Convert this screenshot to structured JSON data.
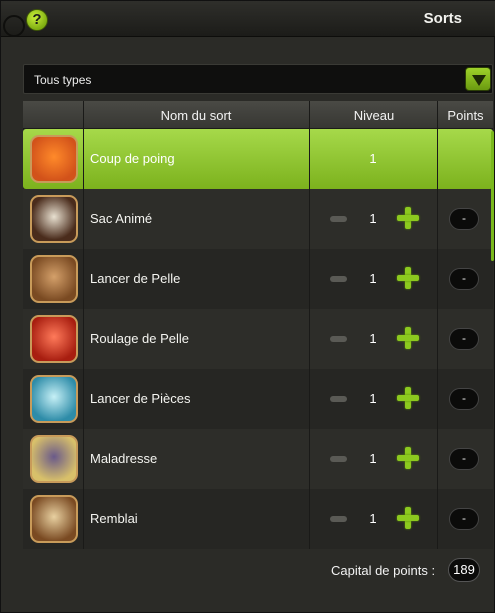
{
  "window": {
    "title": "Sorts",
    "help_label": "?"
  },
  "filter": {
    "selected": "Tous types"
  },
  "table": {
    "headers": {
      "name": "Nom du sort",
      "level": "Niveau",
      "points": "Points"
    }
  },
  "spells": [
    {
      "name": "Coup de poing",
      "level": "1",
      "points": "",
      "icon": "fist-icon",
      "selected": true
    },
    {
      "name": "Sac Animé",
      "level": "1",
      "points": "-",
      "icon": "sack-icon",
      "selected": false
    },
    {
      "name": "Lancer de Pelle",
      "level": "1",
      "points": "-",
      "icon": "shovel-throw-icon",
      "selected": false
    },
    {
      "name": "Roulage de Pelle",
      "level": "1",
      "points": "-",
      "icon": "shovel-roll-icon",
      "selected": false
    },
    {
      "name": "Lancer de Pièces",
      "level": "1",
      "points": "-",
      "icon": "coins-icon",
      "selected": false
    },
    {
      "name": "Maladresse",
      "level": "1",
      "points": "-",
      "icon": "clumsy-icon",
      "selected": false
    },
    {
      "name": "Remblai",
      "level": "1",
      "points": "-",
      "icon": "embankment-icon",
      "selected": false
    }
  ],
  "footer": {
    "capital_label": "Capital de points :",
    "capital_value": "189"
  },
  "colors": {
    "accent": "#8cc91f",
    "selected_row": "#a6d94a"
  }
}
